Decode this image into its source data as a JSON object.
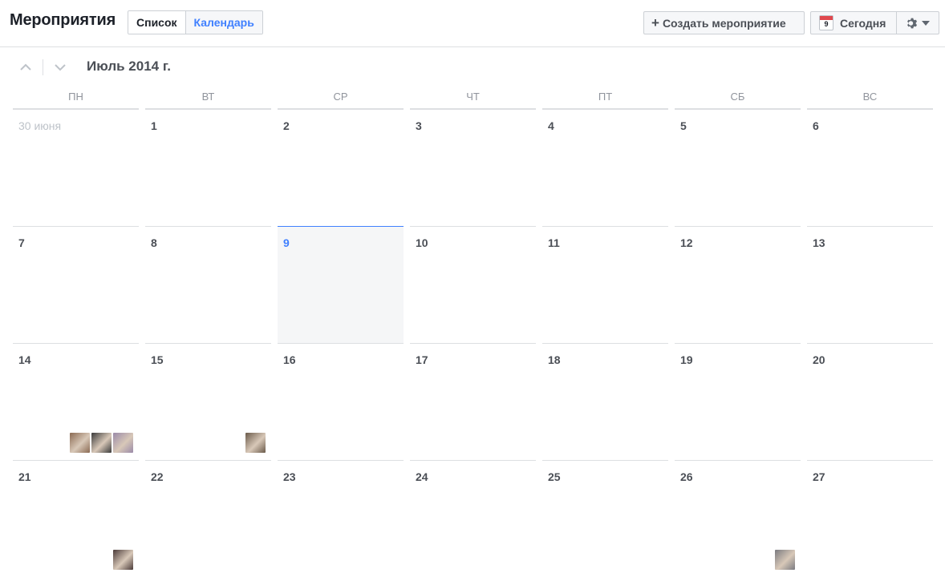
{
  "header": {
    "title": "Мероприятия",
    "view_list": "Список",
    "view_calendar": "Календарь",
    "create_label": "Создать мероприятие",
    "today_label": "Сегодня",
    "today_icon_day": "9"
  },
  "calendar": {
    "month_label": "Июль 2014 г.",
    "weekdays": [
      "ПН",
      "ВТ",
      "СР",
      "ЧТ",
      "ПТ",
      "СБ",
      "ВС"
    ],
    "days": [
      {
        "label": "30 июня",
        "other": true
      },
      {
        "label": "1"
      },
      {
        "label": "2"
      },
      {
        "label": "3"
      },
      {
        "label": "4"
      },
      {
        "label": "5"
      },
      {
        "label": "6"
      },
      {
        "label": "7"
      },
      {
        "label": "8"
      },
      {
        "label": "9",
        "today": true
      },
      {
        "label": "10"
      },
      {
        "label": "11"
      },
      {
        "label": "12"
      },
      {
        "label": "13"
      },
      {
        "label": "14",
        "avatars": [
          "#8a6a52",
          "#3a3a3a",
          "#9a8aa8"
        ]
      },
      {
        "label": "15",
        "avatars": [
          "#6a5a4a"
        ]
      },
      {
        "label": "16"
      },
      {
        "label": "17"
      },
      {
        "label": "18"
      },
      {
        "label": "19"
      },
      {
        "label": "20"
      },
      {
        "label": "21",
        "avatars": [
          "#4a3a38"
        ]
      },
      {
        "label": "22"
      },
      {
        "label": "23"
      },
      {
        "label": "24"
      },
      {
        "label": "25"
      },
      {
        "label": "26",
        "avatars": [
          "#7a7a80"
        ]
      },
      {
        "label": "27"
      }
    ]
  },
  "colors": {
    "accent": "#4080ff",
    "border": "#dddfe2",
    "today_bg": "#f5f6f7"
  }
}
